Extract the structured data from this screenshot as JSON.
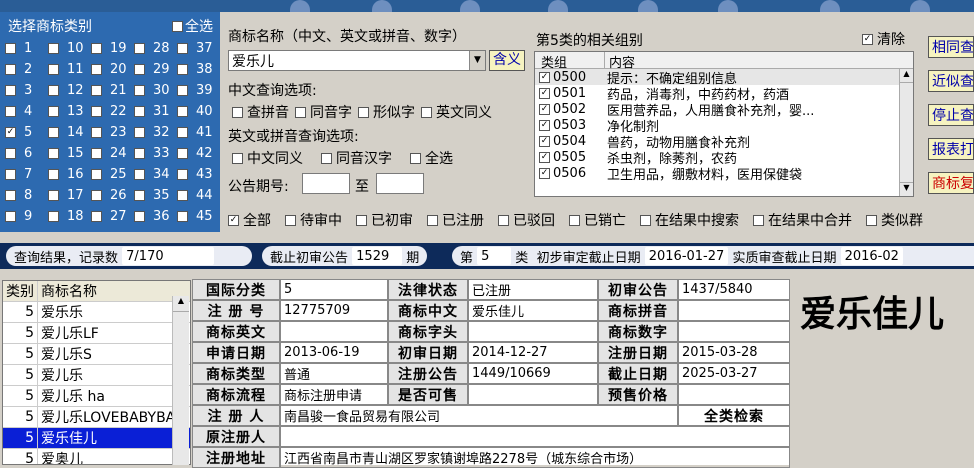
{
  "class_panel": {
    "title": "选择商标类别",
    "select_all": "全选",
    "rows": [
      [
        "1",
        "10",
        "19",
        "28",
        "37"
      ],
      [
        "2",
        "11",
        "20",
        "29",
        "38"
      ],
      [
        "3",
        "12",
        "21",
        "30",
        "39"
      ],
      [
        "4",
        "13",
        "22",
        "31",
        "40"
      ],
      [
        "5",
        "14",
        "23",
        "32",
        "41"
      ],
      [
        "6",
        "15",
        "24",
        "33",
        "42"
      ],
      [
        "7",
        "16",
        "25",
        "34",
        "43"
      ],
      [
        "8",
        "17",
        "26",
        "35",
        "44"
      ],
      [
        "9",
        "18",
        "27",
        "36",
        "45"
      ]
    ],
    "checked": "5"
  },
  "search": {
    "name_label": "商标名称（中文、英文或拼音、数字）",
    "name_value": "爱乐儿",
    "contain_btn": "含义",
    "cn_options_label": "中文查询选项:",
    "cn_options": [
      "查拼音",
      "同音字",
      "形似字",
      "英文同义"
    ],
    "en_options_label": "英文或拼音查询选项:",
    "en_options": [
      "中文同义",
      "同音汉字",
      "全选"
    ],
    "period_label": "公告期号:",
    "period_to": "至"
  },
  "groups": {
    "title": "第5类的相关组别",
    "clear_label": "清除",
    "col_group": "类组",
    "col_content": "内容",
    "items": [
      {
        "code": "0500",
        "text": "提示：不确定组别信息"
      },
      {
        "code": "0501",
        "text": "药品，消毒剂，中药药材，药酒"
      },
      {
        "code": "0502",
        "text": "医用营养品，人用膳食补充剂，婴..."
      },
      {
        "code": "0503",
        "text": "净化制剂"
      },
      {
        "code": "0504",
        "text": "兽药，动物用膳食补充剂"
      },
      {
        "code": "0505",
        "text": "杀虫剂，除莠剂，农药"
      },
      {
        "code": "0506",
        "text": "卫生用品，绷敷材料，医用保健袋"
      }
    ]
  },
  "right_buttons": [
    "相同查",
    "近似查",
    "停止查",
    "报表打",
    "商标复"
  ],
  "filters": [
    "全部",
    "待审中",
    "已初审",
    "已注册",
    "已驳回",
    "已销亡",
    "在结果中搜索",
    "在结果中合并",
    "类似群"
  ],
  "info_bar": {
    "result_label": "查询结果，记录数",
    "result_count": "7/170",
    "deadline_label": "截止初审公告",
    "deadline_value": "1529",
    "deadline_unit": "期",
    "class_prefix": "第",
    "class_value": "5",
    "class_suffix": "类",
    "prelim_label": "初步审定截止日期",
    "prelim_value": "2016-01-27",
    "substantive_label": "实质审查截止日期",
    "substantive_value": "2016-02"
  },
  "results": {
    "col_class": "类别",
    "col_name": "商标名称",
    "rows": [
      {
        "cls": "5",
        "name": "爱乐乐"
      },
      {
        "cls": "5",
        "name": "爱儿乐LF"
      },
      {
        "cls": "5",
        "name": "爱儿乐S"
      },
      {
        "cls": "5",
        "name": "爱儿乐"
      },
      {
        "cls": "5",
        "name": "爱儿乐 ha"
      },
      {
        "cls": "5",
        "name": "爱儿乐LOVEBABYBA"
      },
      {
        "cls": "5",
        "name": "爱乐佳儿"
      },
      {
        "cls": "5",
        "name": "爱奥儿"
      }
    ],
    "selected_index": 6
  },
  "detail": {
    "intl_class_k": "国际分类",
    "intl_class": "5",
    "legal_status_k": "法律状态",
    "legal_status": "已注册",
    "prelim_pub_k": "初审公告",
    "prelim_pub": "1437/5840",
    "reg_no_k": "注 册 号",
    "reg_no": "12775709",
    "cn_name_k": "商标中文",
    "cn_name": "爱乐佳儿",
    "pinyin_k": "商标拼音",
    "pinyin": "",
    "en_name_k": "商标英文",
    "en_name": "",
    "initials_k": "商标字头",
    "initials": "",
    "digits_k": "商标数字",
    "digits": "",
    "apply_date_k": "申请日期",
    "apply_date": "2013-06-19",
    "prelim_date_k": "初审日期",
    "prelim_date": "2014-12-27",
    "reg_date_k": "注册日期",
    "reg_date": "2015-03-28",
    "tm_type_k": "商标类型",
    "tm_type": "普通",
    "reg_pub_k": "注册公告",
    "reg_pub": "1449/10669",
    "expire_k": "截止日期",
    "expire": "2025-03-27",
    "flow_k": "商标流程",
    "flow": "商标注册申请",
    "saleable_k": "是否可售",
    "saleable": "",
    "presale_k": "预售价格",
    "presale": "",
    "registrant_k": "注 册 人",
    "registrant": "南昌骏一食品贸易有限公司",
    "all_search": "全类检索",
    "orig_registrant_k": "原注册人",
    "orig_registrant": "",
    "address_k": "注册地址",
    "address": "江西省南昌市青山湖区罗家镇谢埠路2278号（城东综合市场）"
  },
  "big_name": "爱乐佳儿"
}
